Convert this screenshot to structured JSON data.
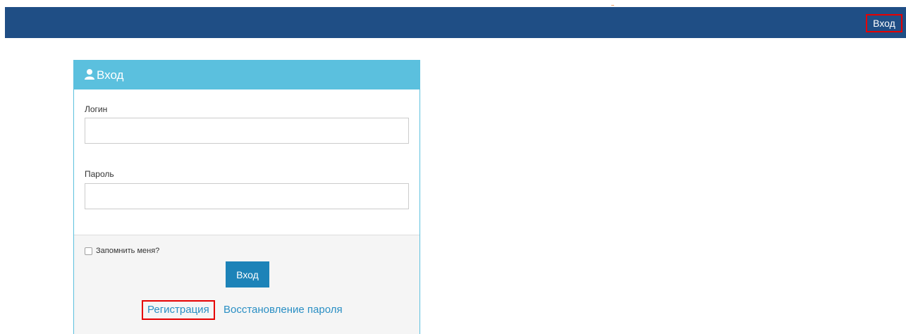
{
  "navbar": {
    "login_label": "Вход",
    "background_color": "#1f4e85"
  },
  "login_panel": {
    "title": "Вход",
    "title_icon": "user-icon",
    "header_color": "#5bc0de",
    "username": {
      "label": "Логин",
      "value": ""
    },
    "password": {
      "label": "Пароль",
      "value": ""
    },
    "remember_me": {
      "label": "Запомнить меня?",
      "checked": false
    },
    "submit_label": "Вход",
    "register_link": "Регистрация",
    "recover_link": "Восстановление пароля",
    "link_color": "#2a8fc4",
    "highlight_color": "#e60000"
  }
}
